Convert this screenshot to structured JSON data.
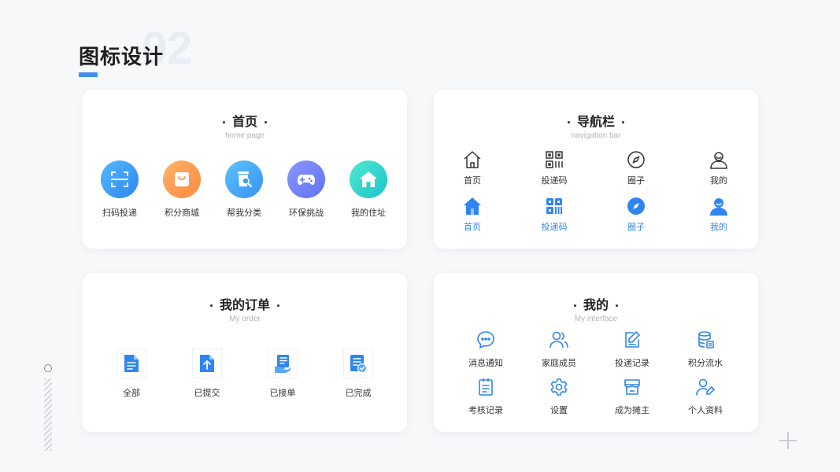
{
  "page": {
    "title": "图标设计",
    "number": "02"
  },
  "colors": {
    "accent": "#3f8ef0",
    "active": "#2f86f0"
  },
  "home": {
    "title": "首页",
    "subtitle": "home page",
    "items": [
      {
        "label": "扫码投递",
        "icon": "scan-icon"
      },
      {
        "label": "积分商城",
        "icon": "shopping-bag-icon"
      },
      {
        "label": "帮我分类",
        "icon": "trash-search-icon"
      },
      {
        "label": "环保挑战",
        "icon": "gamepad-icon"
      },
      {
        "label": "我的住址",
        "icon": "house-icon"
      }
    ]
  },
  "nav": {
    "title": "导航栏",
    "subtitle": "navigation bar",
    "items": [
      {
        "label": "首页",
        "icon": "house-outline-icon"
      },
      {
        "label": "投递码",
        "icon": "qr-code-outline-icon"
      },
      {
        "label": "圈子",
        "icon": "compass-outline-icon"
      },
      {
        "label": "我的",
        "icon": "user-outline-icon"
      }
    ],
    "active_items": [
      {
        "label": "首页",
        "icon": "house-filled-icon"
      },
      {
        "label": "投递码",
        "icon": "qr-code-filled-icon"
      },
      {
        "label": "圈子",
        "icon": "compass-filled-icon"
      },
      {
        "label": "我的",
        "icon": "user-filled-icon"
      }
    ]
  },
  "order": {
    "title": "我的订单",
    "subtitle": "My order",
    "items": [
      {
        "label": "全部",
        "icon": "document-icon"
      },
      {
        "label": "已提交",
        "icon": "upload-document-icon"
      },
      {
        "label": "已接单",
        "icon": "hand-document-icon"
      },
      {
        "label": "已完成",
        "icon": "check-document-icon"
      }
    ]
  },
  "mine": {
    "title": "我的",
    "subtitle": "My interface",
    "items": [
      {
        "label": "消息通知",
        "icon": "chat-bubble-icon"
      },
      {
        "label": "家庭成员",
        "icon": "family-icon"
      },
      {
        "label": "投递记录",
        "icon": "edit-record-icon"
      },
      {
        "label": "积分流水",
        "icon": "database-icon"
      },
      {
        "label": "考核记录",
        "icon": "clipboard-icon"
      },
      {
        "label": "设置",
        "icon": "gear-icon"
      },
      {
        "label": "成为摊主",
        "icon": "shop-icon"
      },
      {
        "label": "个人资料",
        "icon": "user-edit-icon"
      }
    ]
  }
}
